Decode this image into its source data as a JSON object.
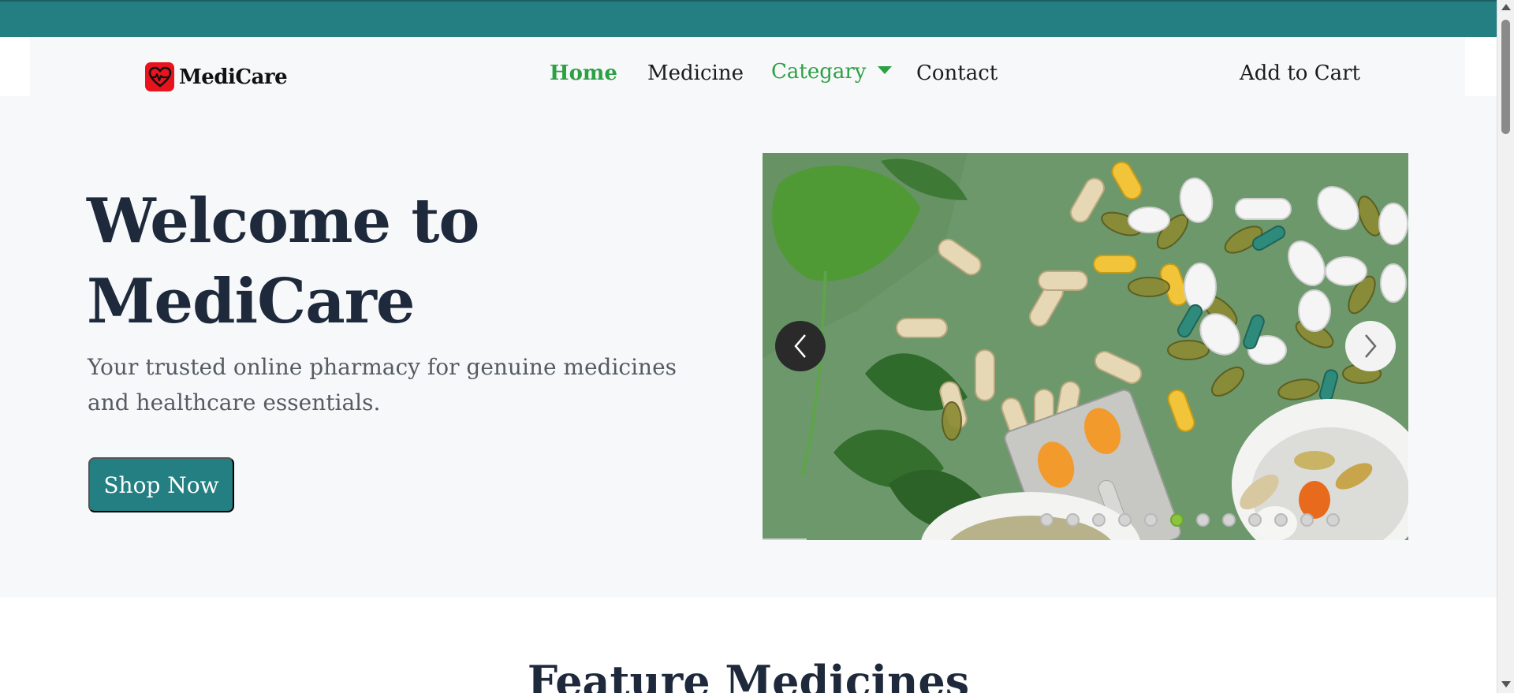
{
  "brand": {
    "name": "MediCare",
    "icon": "heart-pulse-icon",
    "icon_color": "#e8141d"
  },
  "nav": {
    "home": "Home",
    "medicine": "Medicine",
    "category": "Categary",
    "contact": "Contact",
    "cart": "Add to Cart",
    "active_color": "#2ea044"
  },
  "hero": {
    "title_line1": "Welcome to",
    "title_line2": "MediCare",
    "subtitle": "Your trusted online pharmacy for genuine medicines and healthcare essentials.",
    "cta": "Shop Now"
  },
  "carousel": {
    "slide_count": 12,
    "active_slide": 6,
    "prev_icon": "chevron-left-icon",
    "next_icon": "chevron-right-icon",
    "active_dot_color": "#8bc53f"
  },
  "features": {
    "title": "Feature Medicines"
  },
  "colors": {
    "primary": "#237f82",
    "heading": "#1e2a3b",
    "accent_green": "#2ea044"
  }
}
